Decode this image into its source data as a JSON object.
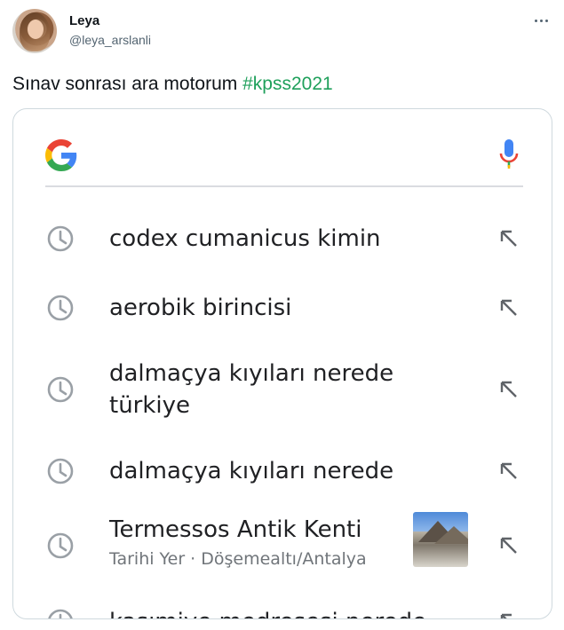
{
  "tweet": {
    "author_name": "Leya",
    "author_handle": "@leya_arslanli",
    "text_main": "Sınav  sonrası ara motorum ",
    "hashtag": "#kpss2021"
  },
  "search": {
    "suggestions": [
      {
        "line1": "codex cumanicus kimin",
        "line2": ""
      },
      {
        "line1": "aerobik birincisi",
        "line2": ""
      },
      {
        "line1": "dalmaçya kıyıları nerede",
        "line2": "türkiye"
      },
      {
        "line1": "dalmaçya kıyıları nerede",
        "line2": ""
      },
      {
        "line1": "Termessos Antik Kenti",
        "subtitle": "Tarihi Yer · Döşemealtı/Antalya"
      },
      {
        "line1": "kasımiye medresesi nerede",
        "line2": ""
      }
    ]
  },
  "icons": {
    "more": "more-dots-icon",
    "google": "google-logo-icon",
    "mic": "microphone-icon",
    "history": "history-clock-icon",
    "fill": "fill-query-arrow-icon"
  },
  "colors": {
    "hashtag": "#1fa05b",
    "secondary_text": "#536471",
    "icon_gray": "#70757a"
  }
}
